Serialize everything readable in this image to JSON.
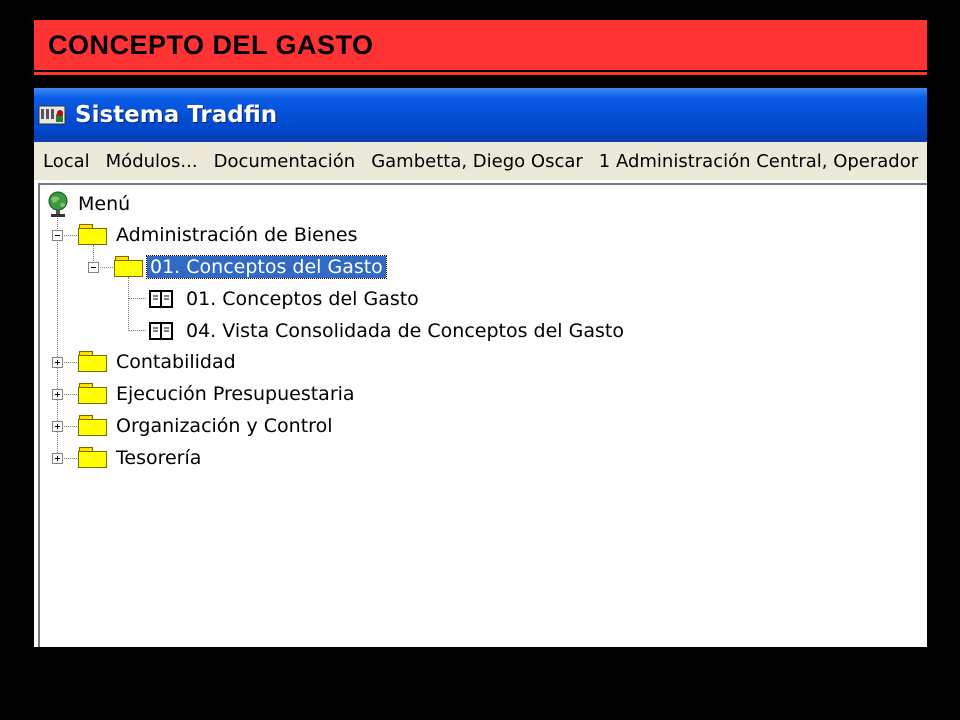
{
  "banner": {
    "title": "CONCEPTO DEL GASTO"
  },
  "window": {
    "title": "Sistema Tradfin",
    "menu": [
      "Local",
      "Módulos...",
      "Documentación",
      "Gambetta, Diego Oscar",
      "1 Administración Central, Operador"
    ]
  },
  "tree": {
    "root": "Menú",
    "admin": "Administración de Bienes",
    "conceptos_folder": "01. Conceptos del Gasto",
    "leaf1": "01.  Conceptos del Gasto",
    "leaf2": "04.  Vista Consolidada de Conceptos del Gasto",
    "contabilidad": "Contabilidad",
    "ejecucion": "Ejecución Presupuestaria",
    "organizacion": "Organización y Control",
    "tesoreria": "Tesorería"
  },
  "colors": {
    "banner": "#ff3333",
    "titlebar": "#0450d6",
    "menubar": "#ece9d8",
    "selection": "#316ac5",
    "folder": "#ffff00"
  }
}
